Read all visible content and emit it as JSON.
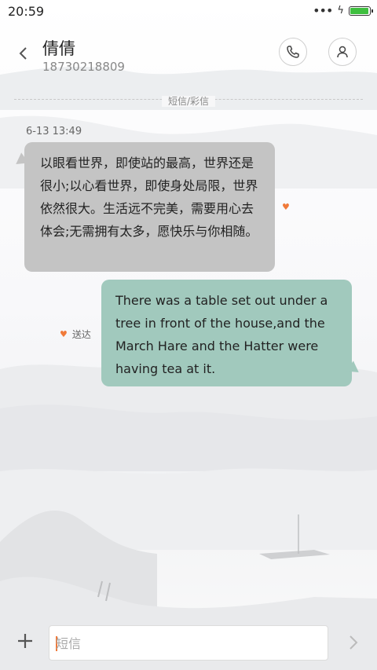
{
  "status_bar": {
    "time": "20:59",
    "battery_level": 0.95
  },
  "header": {
    "contact_name": "倩倩",
    "contact_number": "18730218809"
  },
  "divider": {
    "label": "短信/彩信"
  },
  "conversation": {
    "timestamp": "6-13 13:49",
    "incoming": {
      "text": "以眼看世界，即使站的最高，世界还是很小;以心看世界，即使身处局限，世界依然很大。生活远不完美，需要用心去体会;无需拥有太多，愿快乐与你相随。"
    },
    "outgoing": {
      "text": "There was a table set out under a tree in front of the house,and the March Hare and the Hatter were having tea at it.",
      "status": "送达"
    }
  },
  "composer": {
    "placeholder": "短信"
  },
  "colors": {
    "incoming_bubble": "#c4c4c4",
    "outgoing_bubble": "#a1c9bd",
    "accent": "#f07a3a"
  },
  "icons": [
    "back-icon",
    "phone-icon",
    "person-icon",
    "heart-icon",
    "add-icon",
    "send-icon"
  ]
}
